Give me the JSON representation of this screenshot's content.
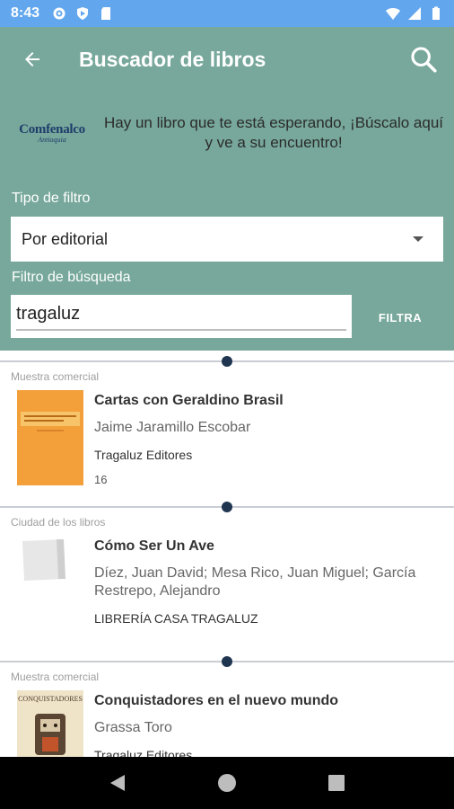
{
  "status": {
    "time": "8:43"
  },
  "appbar": {
    "title": "Buscador de libros"
  },
  "banner": {
    "logo_main": "Comfenalco",
    "logo_sub": "Antioquia",
    "text": "Hay un libro que te está esperando, ¡Búscalo aquí y ve a su encuentro!"
  },
  "filters": {
    "tipo_label": "Tipo de filtro",
    "tipo_value": "Por editorial",
    "busqueda_label": "Filtro de búsqueda",
    "busqueda_value": "tragaluz",
    "button_label": "FILTRA"
  },
  "results": [
    {
      "source": "Muestra comercial",
      "title": "Cartas con Geraldino Brasil",
      "author": "Jaime Jaramillo Escobar",
      "publisher": "Tragaluz Editores",
      "count": "16"
    },
    {
      "source": "Ciudad de los libros",
      "title": "Cómo Ser Un Ave",
      "author": "Díez, Juan David; Mesa Rico, Juan Miguel; García Restrepo, Alejandro",
      "publisher": "LIBRERÍA CASA TRAGALUZ"
    },
    {
      "source": "Muestra comercial",
      "title": "Conquistadores en el nuevo mundo",
      "author": "Grassa Toro",
      "publisher": "Tragaluz Editores",
      "cover_text": "CONQUISTADORES"
    }
  ],
  "colors": {
    "status_bar": "#62a7ed",
    "appbar": "#77a89b",
    "divider_dot": "#1f3550",
    "cover_orange": "#f3a03a"
  }
}
